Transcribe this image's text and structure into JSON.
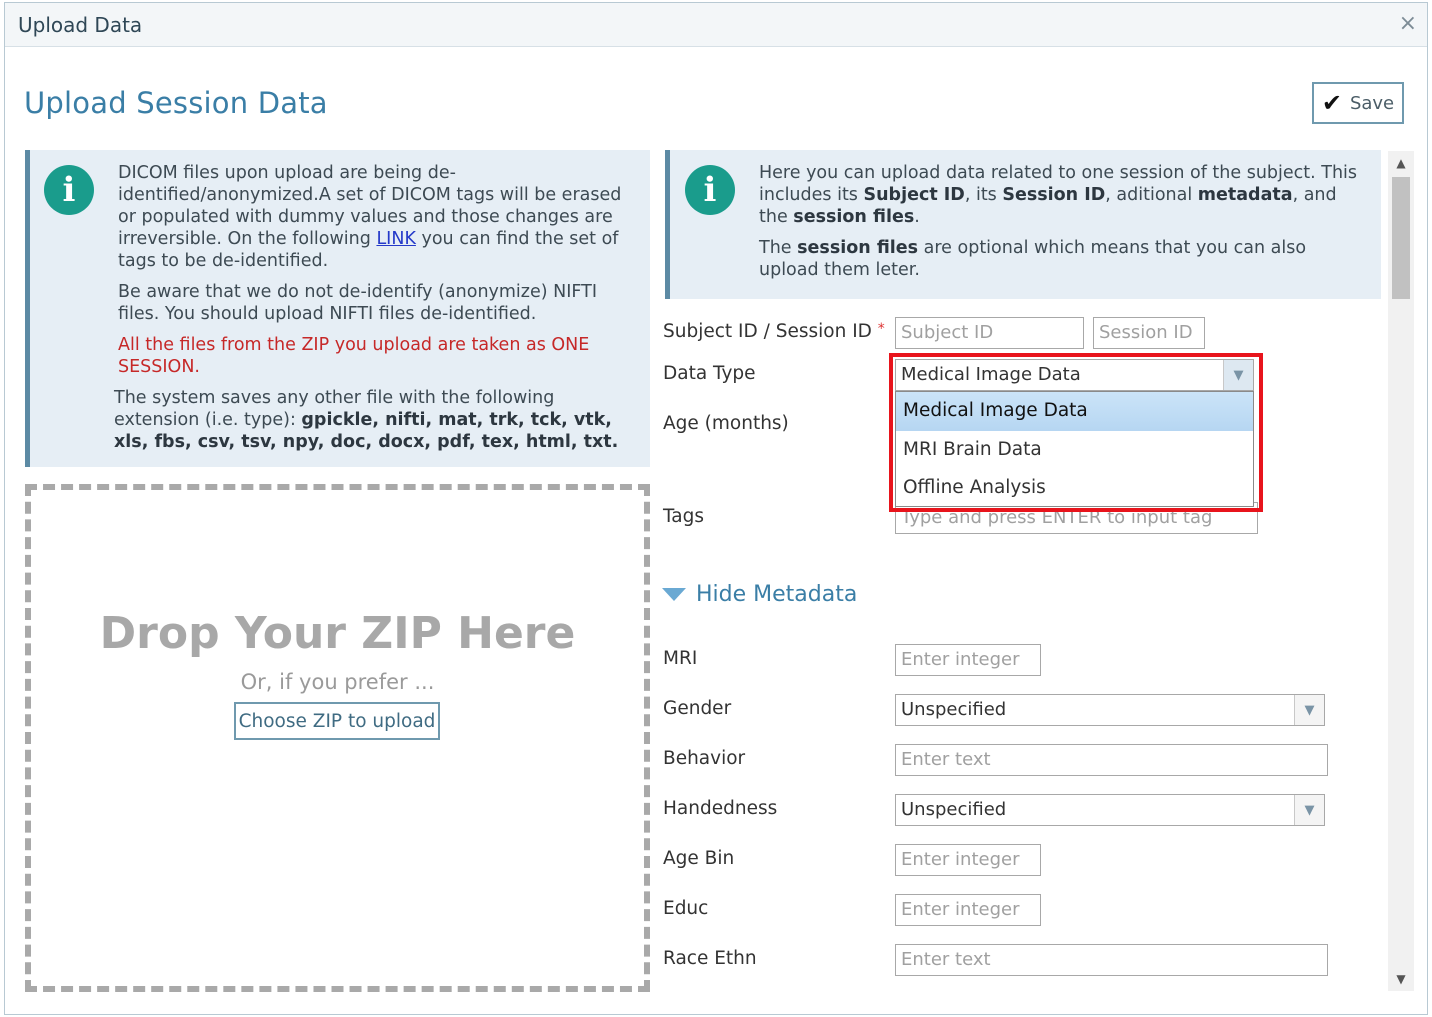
{
  "window": {
    "title": "Upload Data",
    "close_label": "×"
  },
  "page": {
    "title": "Upload Session Data",
    "save_label": "Save"
  },
  "left_info": {
    "p1_a": "DICOM files upon upload are being de-identified/anonymized.A set of DICOM tags will be erased or populated with dummy values and those changes are irreversible. On the following ",
    "p1_link": "LINK",
    "p1_b": " you can find the set of tags to be de-identified.",
    "p2": "Be aware that we do not de-identify (anonymize) NIFTI files. You should upload NIFTI files de-identified.",
    "p3_warning": "All the files from the ZIP you upload are taken as ONE SESSION.",
    "p4_a": "The system saves any other file with the following extension (i.e. type): ",
    "p4_ext": "gpickle, nifti, mat, trk, tck, vtk, xls, fbs, csv, tsv, npy, doc, docx, pdf, tex, html, txt."
  },
  "right_info": {
    "p1_a": "Here you can upload data related to one session of the subject. This includes its ",
    "p1_subject": "Subject ID",
    "p1_b": ", its ",
    "p1_session": "Session ID",
    "p1_c": ", aditional ",
    "p1_metadata": "metadata",
    "p1_d": ", and the ",
    "p1_files": "session files",
    "p1_e": ".",
    "p2_a": "The ",
    "p2_files": "session files",
    "p2_b": " are optional which means that you can also upload them leter."
  },
  "drop_zone": {
    "title": "Drop Your ZIP Here",
    "subtitle": "Or, if you prefer ...",
    "button": "Choose ZIP to upload"
  },
  "form": {
    "subject_session_label": "Subject ID / Session ID",
    "required_mark": "*",
    "subject_placeholder": "Subject ID",
    "session_placeholder": "Session ID",
    "data_type_label": "Data Type",
    "data_type_value": "Medical Image Data",
    "data_type_options": [
      "Medical Image Data",
      "MRI Brain Data",
      "Offline Analysis"
    ],
    "age_label": "Age (months)",
    "tags_label": "Tags",
    "tags_placeholder": "Type and press ENTER to input tag"
  },
  "metadata": {
    "toggle_label": "Hide Metadata",
    "mri_label": "MRI",
    "mri_placeholder": "Enter integer",
    "gender_label": "Gender",
    "gender_value": "Unspecified",
    "behavior_label": "Behavior",
    "behavior_placeholder": "Enter text",
    "handedness_label": "Handedness",
    "handedness_value": "Unspecified",
    "age_bin_label": "Age Bin",
    "age_bin_placeholder": "Enter integer",
    "educ_label": "Educ",
    "educ_placeholder": "Enter integer",
    "race_label": "Race Ethn",
    "race_placeholder": "Enter text"
  },
  "icons": {
    "info": "i",
    "check": "✔",
    "dropdown_arrow": "▼",
    "scroll_up": "▲",
    "scroll_down": "▼"
  },
  "colors": {
    "accent_blue": "#3a7ea6",
    "info_teal": "#1a9c8c",
    "info_bg": "#e6eef5",
    "warning_red": "#c62828",
    "highlight_red": "#e8141c"
  }
}
